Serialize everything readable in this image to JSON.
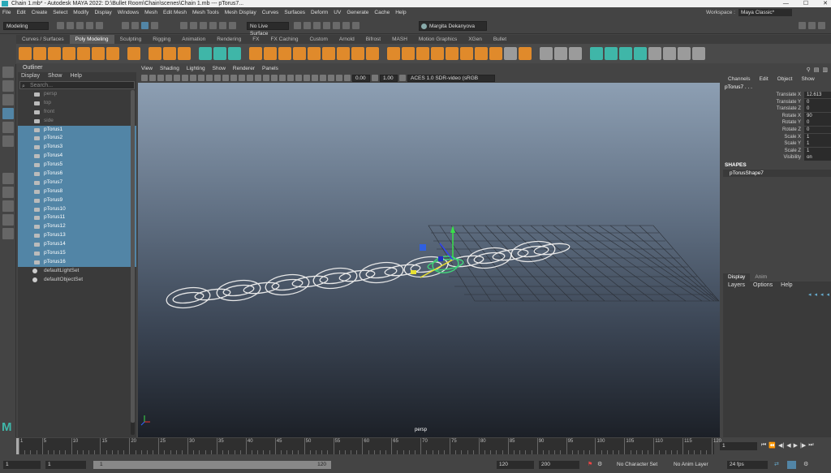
{
  "titlebar": {
    "text": "Chain 1.mb* - Autodesk MAYA 2022: D:\\Bullet Room\\Chain\\scenes\\Chain 1.mb  ---  pTorus7..."
  },
  "menubar": [
    "File",
    "Edit",
    "Create",
    "Select",
    "Modify",
    "Display",
    "Windows",
    "Mesh",
    "Edit Mesh",
    "Mesh Tools",
    "Mesh Display",
    "Curves",
    "Surfaces",
    "Deform",
    "UV",
    "Generate",
    "Cache",
    "Help"
  ],
  "workspace": {
    "label": "Workspace :",
    "value": "Maya Classic*"
  },
  "statusline": {
    "mode": "Modeling",
    "live_surface": "No Live Surface",
    "user": "Margita Dekanyova"
  },
  "shelf_tabs": [
    "Curves / Surfaces",
    "Poly Modeling",
    "Sculpting",
    "Rigging",
    "Animation",
    "Rendering",
    "FX",
    "FX Caching",
    "Custom",
    "Arnold",
    "Bifrost",
    "MASH",
    "Motion Graphics",
    "XGen",
    "Bullet"
  ],
  "shelf_active": "Poly Modeling",
  "outliner": {
    "title": "Outliner",
    "menu": [
      "Display",
      "Show",
      "Help"
    ],
    "search_placeholder": "Search...",
    "cameras": [
      "persp",
      "top",
      "front",
      "side"
    ],
    "objects": [
      "pTorus1",
      "pTorus2",
      "pTorus3",
      "pTorus4",
      "pTorus5",
      "pTorus6",
      "pTorus7",
      "pTorus8",
      "pTorus9",
      "pTorus10",
      "pTorus11",
      "pTorus12",
      "pTorus13",
      "pTorus14",
      "pTorus15",
      "pTorus16"
    ],
    "sets": [
      "defaultLightSet",
      "defaultObjectSet"
    ]
  },
  "viewport": {
    "menu": [
      "View",
      "Shading",
      "Lighting",
      "Show",
      "Renderer",
      "Panels"
    ],
    "exposure": "0.00",
    "gamma": "1.00",
    "color_space": "ACES 1.0 SDR-video (sRGB",
    "camera_label": "persp"
  },
  "channelbox": {
    "menu": [
      "Channels",
      "Edit",
      "Object",
      "Show"
    ],
    "object": "pTorus7 . . .",
    "attributes": [
      {
        "name": "Translate X",
        "value": "12.613"
      },
      {
        "name": "Translate Y",
        "value": "0"
      },
      {
        "name": "Translate Z",
        "value": "0"
      },
      {
        "name": "Rotate X",
        "value": "90"
      },
      {
        "name": "Rotate Y",
        "value": "0"
      },
      {
        "name": "Rotate Z",
        "value": "0"
      },
      {
        "name": "Scale X",
        "value": "1"
      },
      {
        "name": "Scale Y",
        "value": "1"
      },
      {
        "name": "Scale Z",
        "value": "1"
      },
      {
        "name": "Visibility",
        "value": "on"
      }
    ],
    "shapes_label": "SHAPES",
    "shape_name": "pTorusShape7"
  },
  "layer_editor": {
    "tabs": [
      "Display",
      "Anim"
    ],
    "menu": [
      "Layers",
      "Options",
      "Help"
    ]
  },
  "timeslider": {
    "ticks": [
      "1",
      "5",
      "10",
      "15",
      "20",
      "25",
      "30",
      "35",
      "40",
      "45",
      "50",
      "55",
      "60",
      "65",
      "70",
      "75",
      "80",
      "85",
      "90",
      "95",
      "100",
      "105",
      "110",
      "115",
      "120"
    ],
    "current_frame": "1"
  },
  "rangeslider": {
    "start": "1",
    "start_inner": "1",
    "range_start": "1",
    "range_end": "120",
    "end_inner": "120",
    "end": "200",
    "character_set": "No Character Set",
    "anim_layer": "No Anim Layer",
    "fps": "24 fps"
  }
}
